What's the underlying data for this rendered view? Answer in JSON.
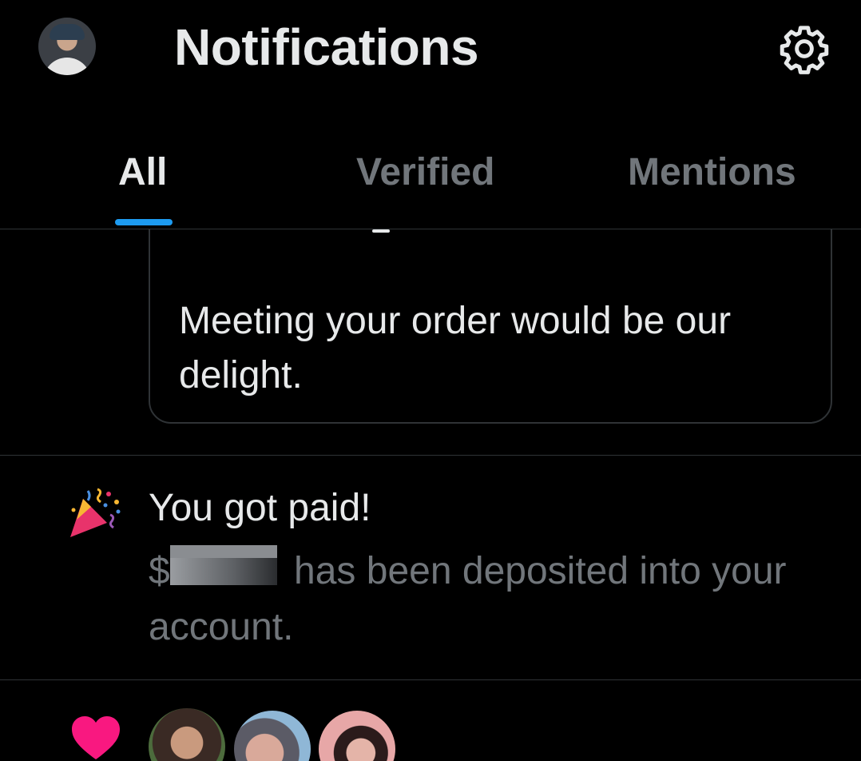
{
  "header": {
    "title": "Notifications",
    "avatar_icon": "user-avatar",
    "settings_icon": "gear-icon"
  },
  "tabs": [
    {
      "label": "All",
      "active": true
    },
    {
      "label": "Verified",
      "active": false
    },
    {
      "label": "Mentions",
      "active": false
    }
  ],
  "message_card": {
    "text": "Meeting your order would be our delight."
  },
  "payment_notification": {
    "icon": "party-popper-icon",
    "title": "You got paid!",
    "currency": "$",
    "amount_redacted": true,
    "body": "has been deposited into your account."
  },
  "likes_notification": {
    "icon": "heart-icon",
    "liker_avatars": [
      "liker-avatar-1",
      "liker-avatar-2",
      "liker-avatar-3"
    ]
  },
  "colors": {
    "background": "#000000",
    "primary_text": "#e7e9ea",
    "secondary_text": "#71767b",
    "accent": "#1d9bf0",
    "heart": "#f91880",
    "divider": "#2f3336"
  }
}
